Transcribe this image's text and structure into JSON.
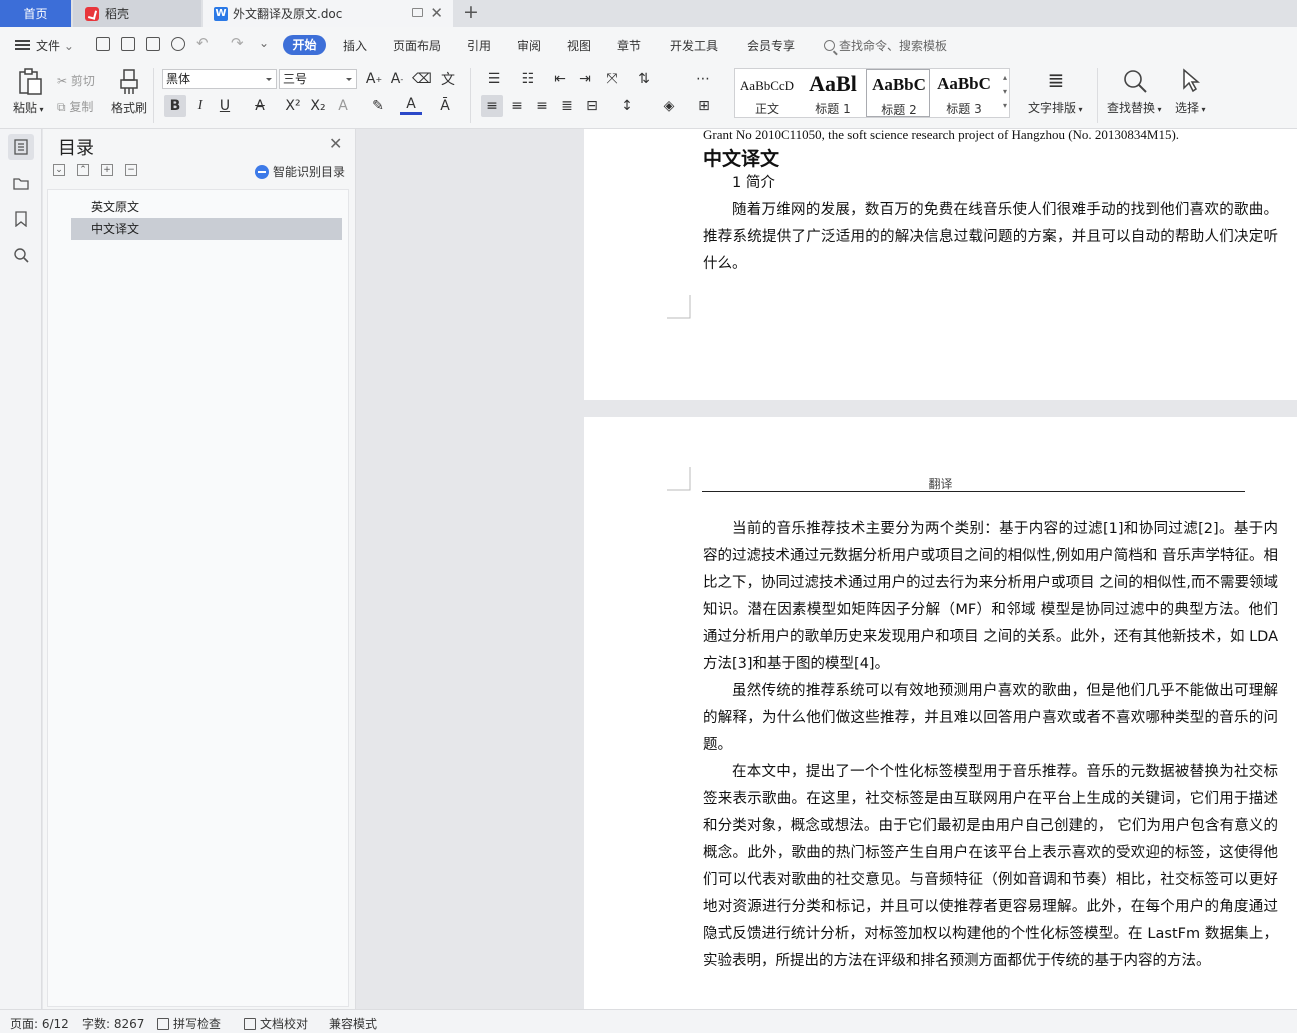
{
  "tabs": {
    "home": "首页",
    "docer": "稻壳",
    "doc_title": "外文翻译及原文.doc",
    "doc_icon": "W"
  },
  "menu": {
    "file": "文件",
    "items": [
      "开始",
      "插入",
      "页面布局",
      "引用",
      "审阅",
      "视图",
      "章节",
      "开发工具",
      "会员专享"
    ],
    "search_placeholder": "查找命令、搜索模板"
  },
  "ribbon": {
    "paste": "粘贴",
    "cut": "剪切",
    "copy": "复制",
    "format_painter": "格式刷",
    "font_name": "黑体",
    "font_size": "三号",
    "styles": [
      {
        "sample": "AaBbCcD",
        "name": "正文"
      },
      {
        "sample": "AaBl",
        "name": "标题 1"
      },
      {
        "sample": "AaBbC",
        "name": "标题 2"
      },
      {
        "sample": "AaBbC",
        "name": "标题 3"
      }
    ],
    "text_layout": "文字排版",
    "find_replace": "查找替换",
    "select": "选择"
  },
  "toc": {
    "title": "目录",
    "smart": "智能识别目录",
    "items": [
      {
        "label": "英文原文",
        "selected": false
      },
      {
        "label": "中文译文",
        "selected": true
      }
    ]
  },
  "document": {
    "page1": {
      "english_line": "Grant No 2010C11050, the soft science research project of Hangzhou (No. 20130834M15).",
      "heading": "中文译文",
      "section": "1 简介",
      "paragraph": "随着万维网的发展，数百万的免费在线音乐使人们很难手动的找到他们喜欢的歌曲。推荐系统提供了广泛适用的的解决信息过载问题的方案，并且可以自动的帮助人们决定听什么。"
    },
    "page2": {
      "header": "翻译",
      "paragraphs": [
        "当前的音乐推荐技术主要分为两个类别：基于内容的过滤[1]和协同过滤[2]。基于内容的过滤技术通过元数据分析用户或项目之间的相似性,例如用户简档和 音乐声学特征。相比之下，协同过滤技术通过用户的过去行为来分析用户或项目 之间的相似性,而不需要领域知识。潜在因素模型如矩阵因子分解（MF）和邻域 模型是协同过滤中的典型方法。他们通过分析用户的歌单历史来发现用户和项目 之间的关系。此外，还有其他新技术，如 LDA 方法[3]和基于图的模型[4]。",
        "虽然传统的推荐系统可以有效地预测用户喜欢的歌曲，但是他们几乎不能做出可理解的解释，为什么他们做这些推荐，并且难以回答用户喜欢或者不喜欢哪种类型的音乐的问题。",
        "在本文中，提出了一个个性化标签模型用于音乐推荐。音乐的元数据被替换为社交标签来表示歌曲。在这里，社交标签是由互联网用户在平台上生成的关键词，它们用于描述和分类对象，概念或想法。由于它们最初是由用户自己创建的， 它们为用户包含有意义的概念。此外，歌曲的热门标签产生自用户在该平台上表示喜欢的受欢迎的标签，这使得他们可以代表对歌曲的社交意见。与音频特征（例如音调和节奏）相比，社交标签可以更好地对资源进行分类和标记，并且可以使推荐者更容易理解。此外，在每个用户的角度通过隐式反馈进行统计分析，对标签加权以构建他的个性化标签模型。在 LastFm 数据集上，实验表明，所提出的方法在评级和排名预测方面都优于传统的基于内容的方法。"
      ]
    }
  },
  "status": {
    "page": "页面: 6/12",
    "words": "字数: 8267",
    "spell": "拼写检查",
    "proof": "文档校对",
    "compat": "兼容模式"
  },
  "colors": {
    "accent": "#3d6fd8",
    "docer": "#e8363b",
    "word": "#2b79e6"
  }
}
